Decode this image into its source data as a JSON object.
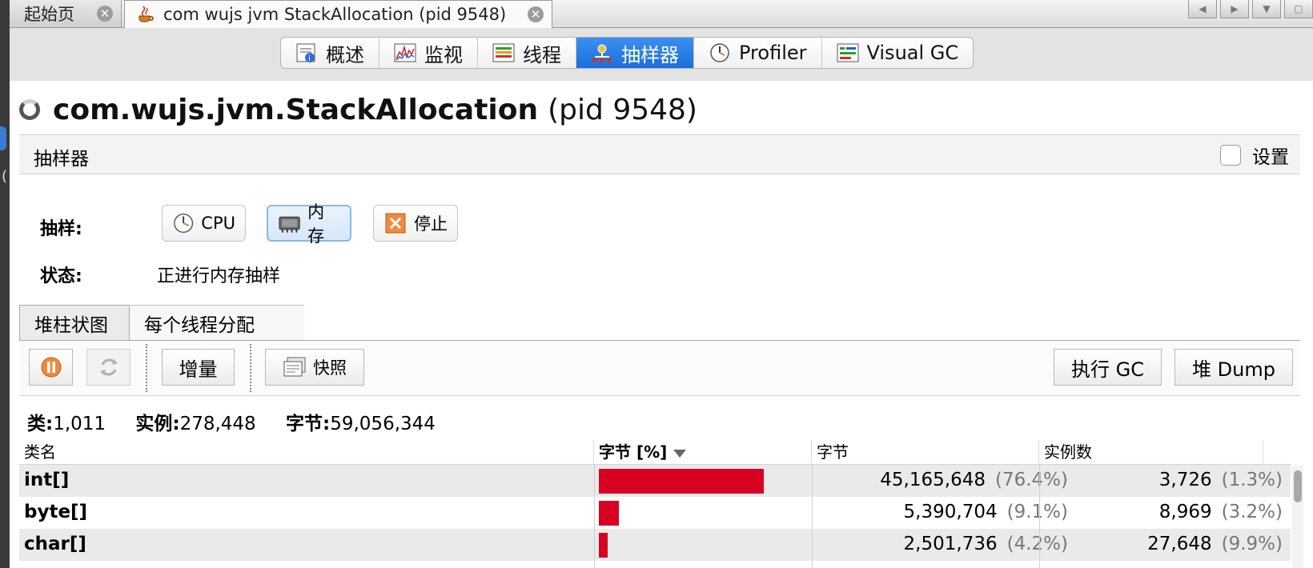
{
  "window": {
    "tabs": [
      {
        "label": "起始页"
      },
      {
        "label": "com wujs jvm StackAllocation (pid 9548)"
      }
    ]
  },
  "view_tabs": [
    {
      "label": "概述",
      "icon": "overview-icon"
    },
    {
      "label": "监视",
      "icon": "monitor-chart-icon"
    },
    {
      "label": "线程",
      "icon": "threads-icon"
    },
    {
      "label": "抽样器",
      "icon": "sampler-icon",
      "active": true
    },
    {
      "label": "Profiler",
      "icon": "clock-icon"
    },
    {
      "label": "Visual GC",
      "icon": "visual-gc-icon"
    }
  ],
  "title": {
    "name": "com.wujs.jvm.StackAllocation",
    "pid": "(pid 9548)"
  },
  "sampler": {
    "header": "抽样器",
    "settings_label": "设置",
    "sample_label": "抽样:",
    "buttons": {
      "cpu": "CPU",
      "memory": "内存",
      "stop": "停止"
    },
    "status_label": "状态:",
    "status_value": "正进行内存抽样"
  },
  "inner_tabs": {
    "heap": "堆柱状图",
    "per_thread": "每个线程分配"
  },
  "toolbar": {
    "delta": "增量",
    "snapshot": "快照",
    "gc": "执行 GC",
    "heap_dump": "堆 Dump"
  },
  "summary": {
    "classes_label": "类:",
    "classes_value": "1,011",
    "instances_label": "实例:",
    "instances_value": "278,448",
    "bytes_label": "字节:",
    "bytes_value": "59,056,344"
  },
  "table": {
    "columns": [
      "类名",
      "字节 [%]",
      "字节",
      "实例数"
    ],
    "rows": [
      {
        "name": "int[]",
        "bytes_pct": 76.4,
        "bytes": "45,165,648",
        "bytes_pct_label": "(76.4%)",
        "instances": "3,726",
        "inst_pct_label": "(1.3%)"
      },
      {
        "name": "byte[]",
        "bytes_pct": 9.1,
        "bytes": "5,390,704",
        "bytes_pct_label": "(9.1%)",
        "instances": "8,969",
        "inst_pct_label": "(3.2%)"
      },
      {
        "name": "char[]",
        "bytes_pct": 4.2,
        "bytes": "2,501,736",
        "bytes_pct_label": "(4.2%)",
        "instances": "27,648",
        "inst_pct_label": "(9.9%)"
      }
    ]
  },
  "colors": {
    "accent": "#1a6fdc",
    "bar": "#d70022"
  }
}
